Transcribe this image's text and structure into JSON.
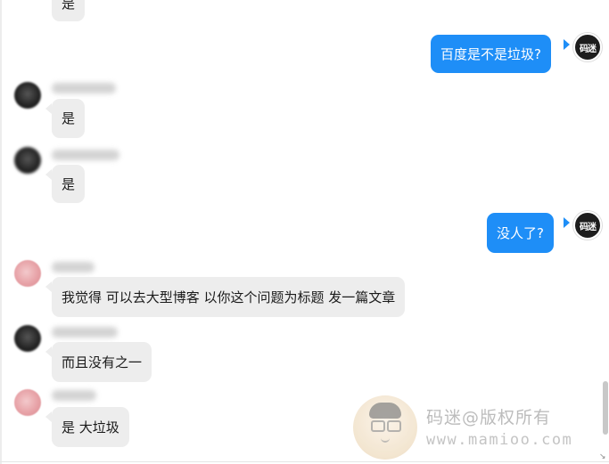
{
  "messages": [
    {
      "id": "m0",
      "side": "in",
      "text": "是",
      "avatar": "none"
    },
    {
      "id": "m1",
      "side": "out",
      "text": "百度是不是垃圾?",
      "avatar_label": "码迷"
    },
    {
      "id": "m2",
      "side": "in",
      "text": "是",
      "avatar": "dark"
    },
    {
      "id": "m3",
      "side": "in",
      "text": "是",
      "avatar": "dark"
    },
    {
      "id": "m4",
      "side": "out",
      "text": "没人了?",
      "avatar_label": "码迷"
    },
    {
      "id": "m5",
      "side": "in",
      "text": "我觉得 可以去大型博客 以你这个问题为标题 发一篇文章",
      "avatar": "pink"
    },
    {
      "id": "m6",
      "side": "in",
      "text": "而且没有之一",
      "avatar": "dark"
    },
    {
      "id": "m7",
      "side": "in",
      "text": "是 大垃圾",
      "avatar": "pink"
    }
  ],
  "watermark": {
    "line1": "码迷@版权所有",
    "line2": "www.mamioo.com"
  },
  "icons": {
    "resize": "resize-corner-icon",
    "self_avatar": "user-avatar-icon"
  },
  "colors": {
    "incoming_bubble": "#ededed",
    "outgoing_bubble": "#1e8ef7"
  }
}
